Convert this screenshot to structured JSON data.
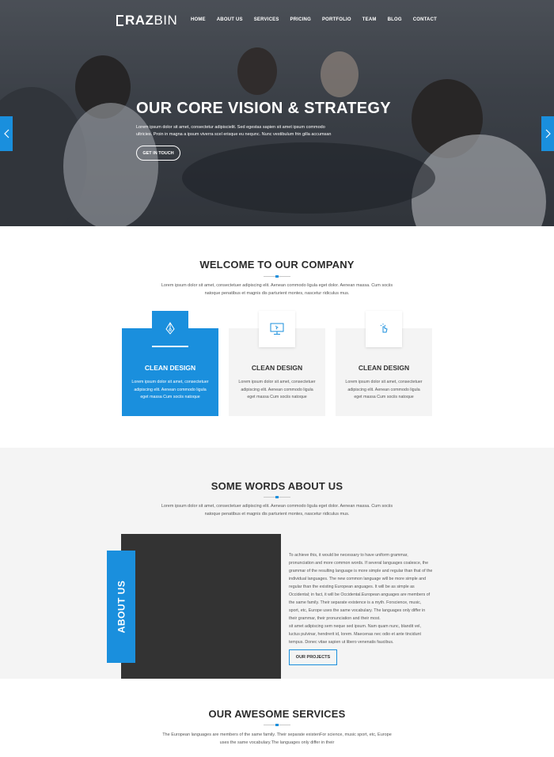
{
  "brand": {
    "logo_bold": "RAZ",
    "logo_light": "BIN"
  },
  "nav": [
    "HOME",
    "ABOUT US",
    "SERVICES",
    "PRICING",
    "PORTFOLIO",
    "TEAM",
    "BLOG",
    "CONTACT"
  ],
  "hero": {
    "title": "OUR CORE VISION & STRATEGY",
    "text": "Lorem ipsum dolor sit amet, consectetur adipiscielit. Sed egestas sapien sit amet ipsum commodo ultricies. Proin in magna a ipsum viverra scel erisque eu nequnc. Nunc vestibulum frin gilla accumsan",
    "button": "GET IN TOUCH"
  },
  "welcome": {
    "title": "WELCOME TO OUR COMPANY",
    "subtitle": "Lorem ipsum dolor sit amet, consectetuer adipiscing elit. Aenean commodo ligula eget dolor. Aenean massa. Cum sociis natoque penatibus et magnis dis parturient montes, nascetur ridiculus mus."
  },
  "features": [
    {
      "title": "CLEAN DESIGN",
      "text": "Lorem ipsum dolor sit amet, consectetuer adipiscing elit. Aenean commodo ligula eget massa Cum sociis natoque",
      "icon": "pen-nib-icon"
    },
    {
      "title": "CLEAN DESIGN",
      "text": "Lorem ipsum dolor sit amet, consectetuer adipiscing elit. Aenean commodo ligula eget massa Cum sociis natoque",
      "icon": "monitor-icon"
    },
    {
      "title": "CLEAN DESIGN",
      "text": "Lorem ipsum dolor sit amet, consectetuer adipiscing elit. Aenean commodo ligula eget massa Cum sociis natoque",
      "icon": "touch-hand-icon"
    }
  ],
  "about": {
    "title": "SOME WORDS ABOUT US",
    "subtitle": "Lorem ipsum dolor sit amet, consectetuer adipiscing elit. Aenean commodo ligula eget dolor. Aenean massa. Cum sociis natoque penatibus et magnis dis parturient montes, nascetur ridiculus mus.",
    "tab_label": "ABOUT US",
    "para1": "To achieve this, it would be necessary to have uniform grammar, pronunciation and more common words. If several languages coalesce, the grammar of the resulting language is more simple and regular than that of the individual languages. The new common language will be more simple and regular than the existing European anguages. It will be as simple as Occidental; in fact, it will be Occidental.European anguages are members of the same family. Their separate existence is a myth. Forscience, music, sport, etc, Europe uses the same vocabulary. The languages only differ in their grammar, their pronunciation and their most.",
    "para2": "sit amet adipiscing sem neque sed ipsum. Nam quam nunc, blandit vel, luctus pulvinar, hendrerit id, lorem. Maecenas nec odio et ante tincidunt tempus. Donec vitae sapien ut libero venenatis faucibus.",
    "button": "OUR PROJECTS"
  },
  "services": {
    "title": "OUR AWESOME SERVICES",
    "subtitle": "The European languages are members of the same family. Their separate existenFor science, music sport, etc, Europe uses the same vocabulary.The languages only differ in their"
  },
  "colors": {
    "accent": "#1a8fdd",
    "dark": "#333333",
    "light_bg": "#f4f4f4"
  }
}
